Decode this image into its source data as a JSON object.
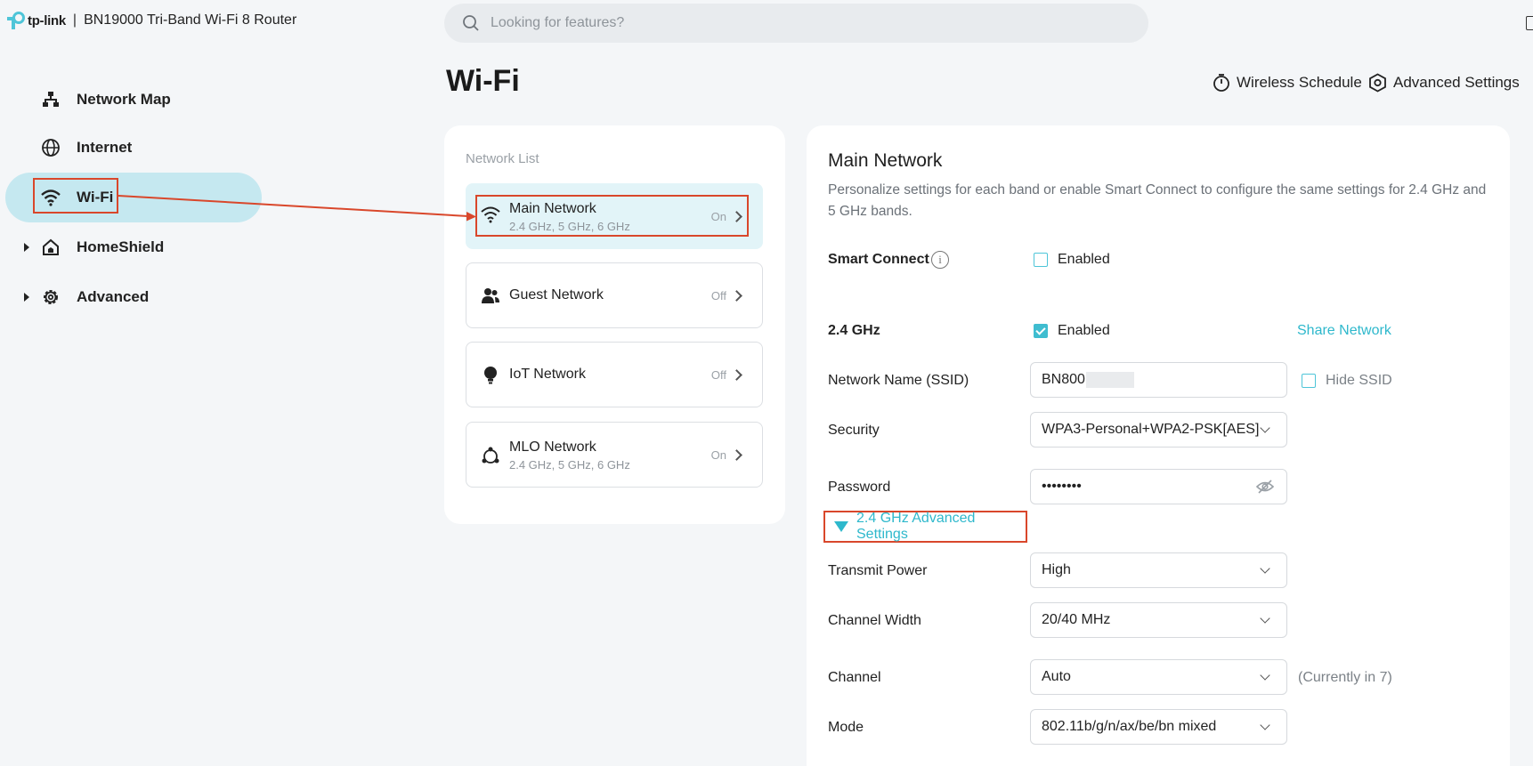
{
  "brand": {
    "logo_text": "tp-link",
    "separator": "|",
    "device": "BN19000 Tri-Band Wi-Fi 8 Router"
  },
  "search": {
    "placeholder": "Looking for features?"
  },
  "sidebar": {
    "items": [
      {
        "label": "Network Map",
        "icon": "network-map-icon"
      },
      {
        "label": "Internet",
        "icon": "globe-icon"
      },
      {
        "label": "Wi-Fi",
        "icon": "wifi-icon",
        "active": true
      },
      {
        "label": "HomeShield",
        "icon": "home-shield-icon",
        "expandable": true
      },
      {
        "label": "Advanced",
        "icon": "gear-icon",
        "expandable": true
      }
    ]
  },
  "page": {
    "title": "Wi-Fi"
  },
  "top_actions": {
    "wireless_schedule": "Wireless Schedule",
    "advanced_settings": "Advanced Settings"
  },
  "network_list": {
    "title": "Network List",
    "items": [
      {
        "name": "Main Network",
        "sub": "2.4 GHz, 5 GHz, 6 GHz",
        "state": "On",
        "icon": "wifi-icon",
        "active": true
      },
      {
        "name": "Guest Network",
        "sub": "",
        "state": "Off",
        "icon": "guests-icon"
      },
      {
        "name": "IoT Network",
        "sub": "",
        "state": "Off",
        "icon": "bulb-icon"
      },
      {
        "name": "MLO Network",
        "sub": "2.4 GHz, 5 GHz, 6 GHz",
        "state": "On",
        "icon": "mlo-icon"
      }
    ]
  },
  "main": {
    "title": "Main Network",
    "description": "Personalize settings for each band or enable Smart Connect to configure the same settings for 2.4 GHz and 5 GHz bands.",
    "smart_connect": {
      "label": "Smart Connect",
      "info": "i",
      "checkbox_label": "Enabled",
      "checked": false
    },
    "band": {
      "label": "2.4 GHz",
      "checkbox_label": "Enabled",
      "checked": true,
      "share_link": "Share Network"
    },
    "ssid": {
      "label": "Network Name (SSID)",
      "value": "BN800",
      "hide_label": "Hide SSID",
      "hide_checked": false
    },
    "security": {
      "label": "Security",
      "value": "WPA3-Personal+WPA2-PSK[AES]"
    },
    "password": {
      "label": "Password",
      "value": "••••••••"
    },
    "advanced_toggle": "2.4 GHz Advanced Settings",
    "transmit_power": {
      "label": "Transmit Power",
      "value": "High"
    },
    "channel_width": {
      "label": "Channel Width",
      "value": "20/40 MHz"
    },
    "channel": {
      "label": "Channel",
      "value": "Auto",
      "hint": "(Currently in 7)"
    },
    "mode": {
      "label": "Mode",
      "value": "802.11b/g/n/ax/be/bn mixed"
    }
  },
  "colors": {
    "accent": "#2eb8cc",
    "active_nav": "#c5e8f0",
    "active_item": "#e2f4f8",
    "highlight": "#d9472b"
  }
}
